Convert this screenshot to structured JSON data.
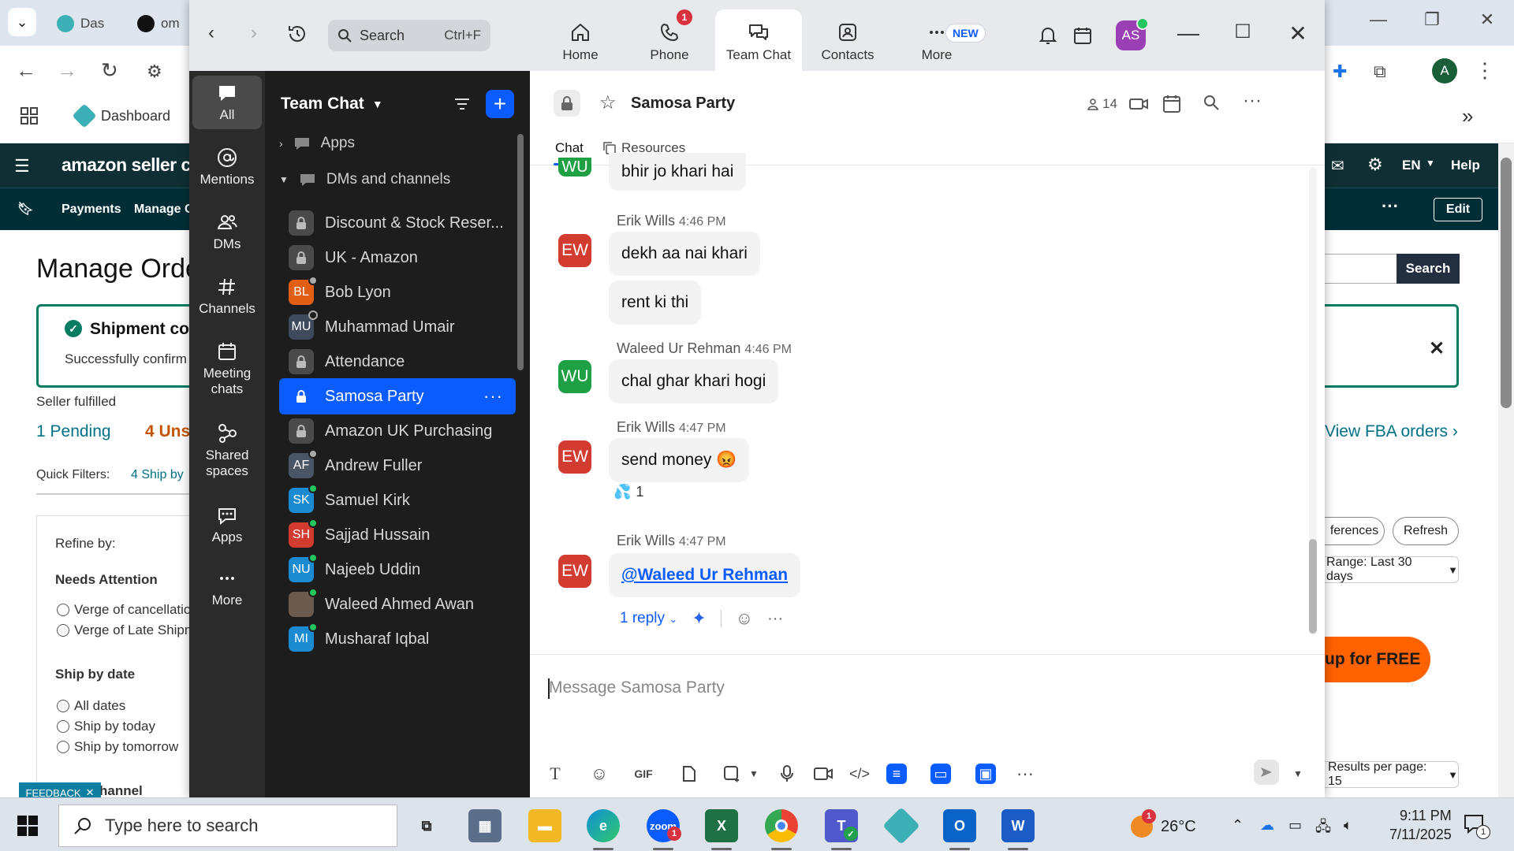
{
  "browser": {
    "tabs": [
      {
        "label": "Das"
      },
      {
        "label": "om"
      }
    ],
    "bookmark": "Dashboard",
    "profile_initial": "A"
  },
  "amazon": {
    "logo": "amazon seller centr",
    "nav_items": [
      "Payments",
      "Manage C"
    ],
    "right_nav": {
      "lang": "EN",
      "help": "Help",
      "edit": "Edit"
    },
    "page_title": "Manage Orde",
    "banner_title": "Shipment co",
    "banner_text": "Successfully confirm",
    "seller_fulfilled": "Seller fulfilled",
    "pending": "1 Pending",
    "unshipped": "4 Uns",
    "quick_filters_label": "Quick Filters:",
    "quick_filter_1": "4 Ship by",
    "refine_by": "Refine by:",
    "needs_attention": "Needs Attention",
    "attention_options": [
      "Verge of cancellatio",
      "Verge of Late Shipm"
    ],
    "ship_by_date": "Ship by date",
    "ship_options": [
      "All dates",
      "Ship by today",
      "Ship by tomorrow"
    ],
    "channel_heading": "hannel",
    "feedback": "FEEDBACK",
    "search_button": "Search",
    "view_fba": "View FBA orders",
    "preferences": "ferences",
    "refresh": "Refresh",
    "range": "Range: Last 30 days",
    "signup": "up for FREE",
    "results_per_page": "Results per page: 15"
  },
  "zoom": {
    "search_placeholder": "Search",
    "search_shortcut": "Ctrl+F",
    "tabs": [
      {
        "label": "Home"
      },
      {
        "label": "Phone",
        "badge": "1"
      },
      {
        "label": "Team Chat"
      },
      {
        "label": "Contacts"
      },
      {
        "label": "More",
        "badge": "NEW"
      }
    ],
    "avatar": "AS",
    "rail": [
      {
        "label": "All"
      },
      {
        "label": "Mentions"
      },
      {
        "label": "DMs"
      },
      {
        "label": "Channels"
      },
      {
        "label": "Meeting chats"
      },
      {
        "label": "Shared spaces"
      },
      {
        "label": "Apps"
      },
      {
        "label": "More"
      }
    ],
    "list": {
      "title": "Team Chat",
      "apps_section": "Apps",
      "dms_section": "DMs and channels",
      "items": [
        {
          "label": "Discount & Stock Reser...",
          "type": "channel"
        },
        {
          "label": "UK - Amazon",
          "type": "channel"
        },
        {
          "label": "Bob Lyon",
          "type": "dm",
          "initials": "BL",
          "color": "#e25e12",
          "status": "away"
        },
        {
          "label": "Muhammad Umair",
          "type": "dm",
          "initials": "MU",
          "color": "#3c4a5c",
          "status": "off"
        },
        {
          "label": "Attendance",
          "type": "channel"
        },
        {
          "label": "Samosa Party",
          "type": "channel",
          "active": true
        },
        {
          "label": "Amazon UK Purchasing",
          "type": "channel"
        },
        {
          "label": "Andrew Fuller",
          "type": "dm",
          "initials": "AF",
          "color": "#4a5566",
          "status": "away"
        },
        {
          "label": "Samuel Kirk",
          "type": "dm",
          "initials": "SK",
          "color": "#1a8bd1",
          "status": "on"
        },
        {
          "label": "Sajjad Hussain",
          "type": "dm",
          "initials": "SH",
          "color": "#d13b30",
          "status": "on"
        },
        {
          "label": "Najeeb Uddin",
          "type": "dm",
          "initials": "NU",
          "color": "#1a8bd1",
          "status": "on"
        },
        {
          "label": "Waleed Ahmed Awan",
          "type": "dm",
          "initials": "",
          "color": "#6b5a4e",
          "status": "on"
        },
        {
          "label": "Musharaf Iqbal",
          "type": "dm",
          "initials": "MI",
          "color": "#1a8bd1",
          "status": "on"
        }
      ]
    },
    "chat": {
      "title": "Samosa Party",
      "members": "14",
      "tabs": [
        "Chat",
        "Resources"
      ],
      "messages": [
        {
          "initials": "WU",
          "text": "bhir jo khari hai"
        },
        {
          "initials": "EW",
          "name": "Erik Wills",
          "time": "4:46 PM",
          "texts": [
            "dekh aa nai khari",
            "rent ki thi"
          ]
        },
        {
          "initials": "WU",
          "name": "Waleed Ur Rehman",
          "time": "4:46 PM",
          "text": "chal ghar khari hogi"
        },
        {
          "initials": "EW",
          "name": "Erik Wills",
          "time": "4:47 PM",
          "text": "send money 😡",
          "reaction": "💦",
          "reaction_count": "1"
        },
        {
          "initials": "EW",
          "name": "Erik Wills",
          "time": "4:47 PM",
          "mention": "@Waleed Ur Rehman",
          "reply": "1 reply"
        }
      ],
      "composer_placeholder": "Message Samosa Party"
    }
  },
  "taskbar": {
    "search_placeholder": "Type here to search",
    "temperature": "26°C",
    "weather_badge": "1",
    "teams_badge": "1",
    "time": "9:11 PM",
    "date": "7/11/2025",
    "notif_count": "1"
  }
}
